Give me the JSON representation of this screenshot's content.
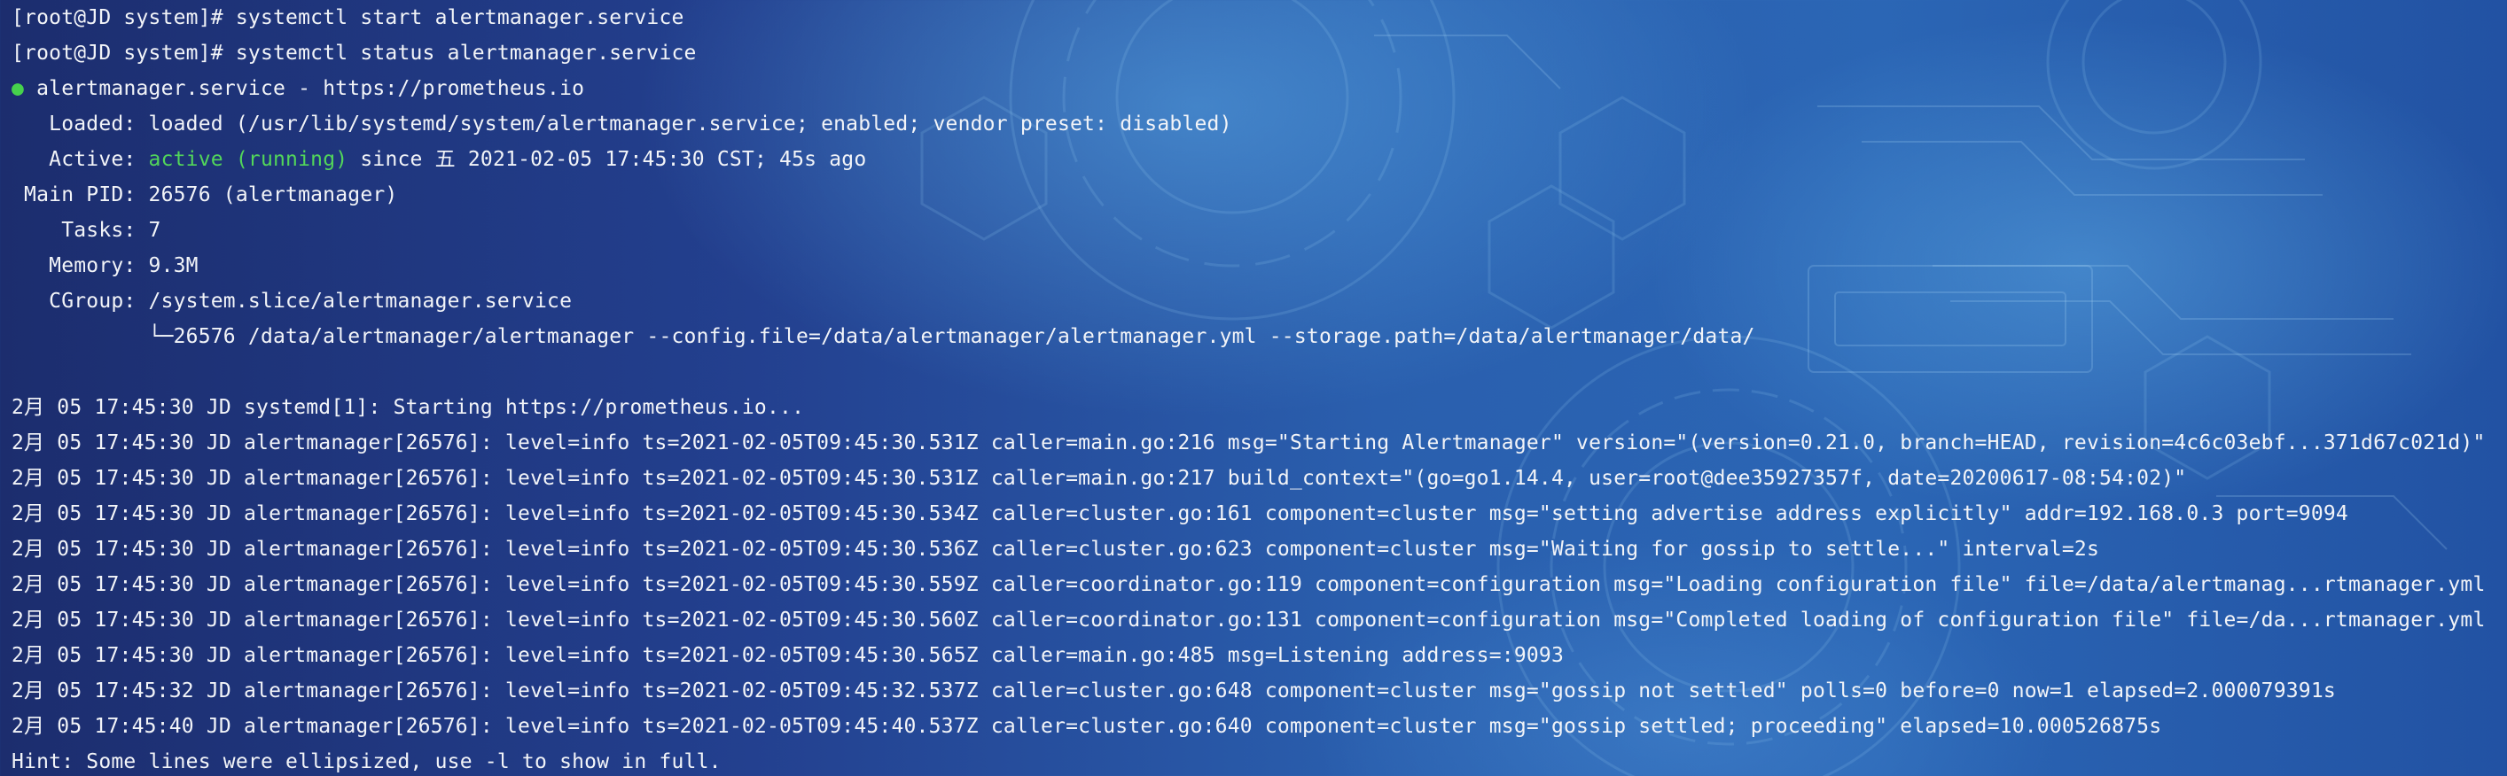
{
  "colors": {
    "text": "#f2f4f8",
    "active_status": "#52d65a",
    "background_start": "#1c2d6e",
    "background_end": "#2b66b5"
  },
  "terminal": {
    "commands": [
      "[root@JD system]# systemctl start alertmanager.service",
      "[root@JD system]# systemctl status alertmanager.service"
    ],
    "status": {
      "bullet": "●",
      "service_line": " alertmanager.service - https://prometheus.io",
      "loaded": "   Loaded: loaded (/usr/lib/systemd/system/alertmanager.service; enabled; vendor preset: disabled)",
      "active_prefix": "   Active: ",
      "active_state": "active (running)",
      "active_suffix": " since 五 2021-02-05 17:45:30 CST; 45s ago",
      "main_pid": " Main PID: 26576 (alertmanager)",
      "tasks": "    Tasks: 7",
      "memory": "   Memory: 9.3M",
      "cgroup": "   CGroup: /system.slice/alertmanager.service",
      "cgroup_child": "           └─26576 /data/alertmanager/alertmanager --config.file=/data/alertmanager/alertmanager.yml --storage.path=/data/alertmanager/data/"
    },
    "log_lines": [
      "2月 05 17:45:30 JD systemd[1]: Starting https://prometheus.io...",
      "2月 05 17:45:30 JD alertmanager[26576]: level=info ts=2021-02-05T09:45:30.531Z caller=main.go:216 msg=\"Starting Alertmanager\" version=\"(version=0.21.0, branch=HEAD, revision=4c6c03ebf...371d67c021d)\"",
      "2月 05 17:45:30 JD alertmanager[26576]: level=info ts=2021-02-05T09:45:30.531Z caller=main.go:217 build_context=\"(go=go1.14.4, user=root@dee35927357f, date=20200617-08:54:02)\"",
      "2月 05 17:45:30 JD alertmanager[26576]: level=info ts=2021-02-05T09:45:30.534Z caller=cluster.go:161 component=cluster msg=\"setting advertise address explicitly\" addr=192.168.0.3 port=9094",
      "2月 05 17:45:30 JD alertmanager[26576]: level=info ts=2021-02-05T09:45:30.536Z caller=cluster.go:623 component=cluster msg=\"Waiting for gossip to settle...\" interval=2s",
      "2月 05 17:45:30 JD alertmanager[26576]: level=info ts=2021-02-05T09:45:30.559Z caller=coordinator.go:119 component=configuration msg=\"Loading configuration file\" file=/data/alertmanag...rtmanager.yml",
      "2月 05 17:45:30 JD alertmanager[26576]: level=info ts=2021-02-05T09:45:30.560Z caller=coordinator.go:131 component=configuration msg=\"Completed loading of configuration file\" file=/da...rtmanager.yml",
      "2月 05 17:45:30 JD alertmanager[26576]: level=info ts=2021-02-05T09:45:30.565Z caller=main.go:485 msg=Listening address=:9093",
      "2月 05 17:45:32 JD alertmanager[26576]: level=info ts=2021-02-05T09:45:32.537Z caller=cluster.go:648 component=cluster msg=\"gossip not settled\" polls=0 before=0 now=1 elapsed=2.000079391s",
      "2月 05 17:45:40 JD alertmanager[26576]: level=info ts=2021-02-05T09:45:40.537Z caller=cluster.go:640 component=cluster msg=\"gossip settled; proceeding\" elapsed=10.000526875s"
    ],
    "hint": "Hint: Some lines were ellipsized, use -l to show in full."
  }
}
